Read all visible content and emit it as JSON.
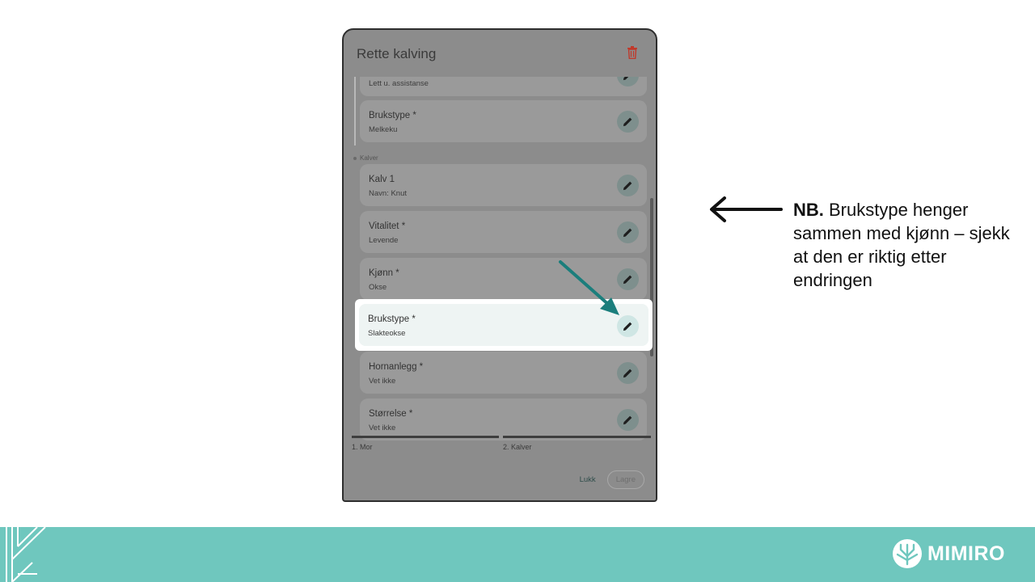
{
  "dialog": {
    "title": "Rette kalving",
    "cards_top": [
      {
        "title": "",
        "value": "Lett u. assistanse"
      },
      {
        "title": "Brukstype *",
        "value": "Melkeku"
      }
    ],
    "section_calves": "Kalver",
    "cards_calves": [
      {
        "title": "Kalv 1",
        "value": "Navn:  Knut"
      },
      {
        "title": "Vitalitet *",
        "value": "Levende"
      },
      {
        "title": "Kjønn *",
        "value": "Okse"
      },
      {
        "title": "Brukstype  *",
        "value": "Slakteokse"
      },
      {
        "title": "Hornanlegg *",
        "value": "Vet ikke"
      },
      {
        "title": "Størrelse *",
        "value": "Vet ikke"
      }
    ],
    "steps": [
      "1. Mor",
      "2. Kalver"
    ],
    "close_label": "Lukk",
    "save_label": "Lagre"
  },
  "annotation": {
    "bold": "NB.",
    "text": " Brukstype henger sammen med kjønn – sjekk at den er riktig etter endringen"
  },
  "brand": {
    "name": "MIMIRO",
    "banner_color": "#6fc7be",
    "arrow_color": "#1b7e7c"
  }
}
